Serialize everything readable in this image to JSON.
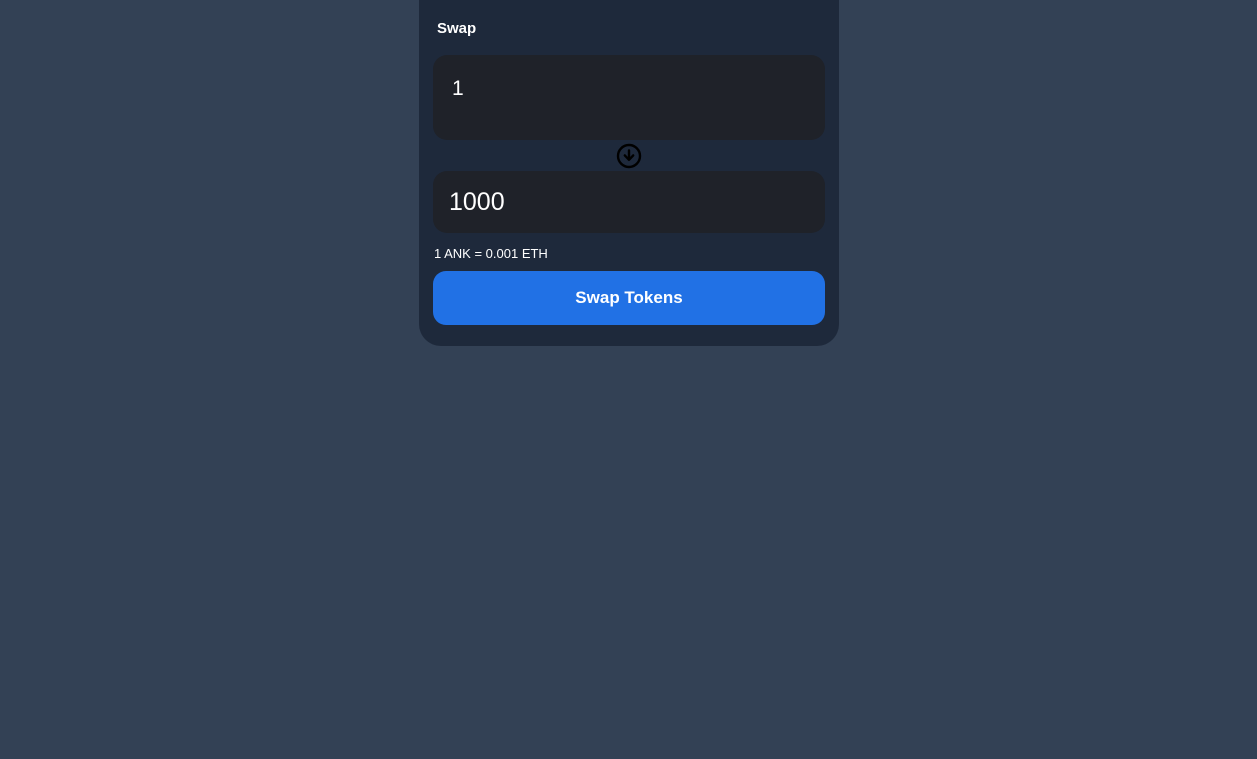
{
  "swap": {
    "title": "Swap",
    "from_amount": "1",
    "to_amount": "1000",
    "direction_icon": "arrow-down-circle-icon",
    "rate_text": "1 ANK = 0.001 ETH",
    "button_label": "Swap Tokens"
  },
  "colors": {
    "background": "#334155",
    "card": "#1e293b",
    "input": "#1f2229",
    "accent": "#2171e5"
  }
}
